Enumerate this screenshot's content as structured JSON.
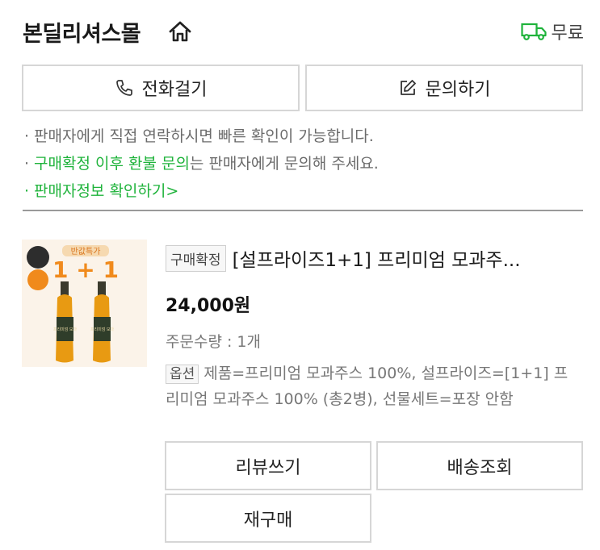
{
  "header": {
    "store_name": "본딜리셔스몰",
    "shipping_label": "무료",
    "accent_color": "#1fb33b"
  },
  "contact_buttons": {
    "call_label": "전화걸기",
    "inquiry_label": "문의하기"
  },
  "notes": {
    "line1": "판매자에게 직접 연락하시면 빠른 확인이 가능합니다.",
    "line2_highlight": "구매확정 이후 환불 문의",
    "line2_rest": "는 판매자에게 문의해 주세요.",
    "line3_link": "판매자정보 확인하기",
    "line3_chevron": ">"
  },
  "order": {
    "status_badge": "구매확정",
    "product_title": "[설프라이즈1+1] 프리미엄 모과주...",
    "price": "24,000원",
    "quantity": "주문수량 : 1개",
    "option_label": "옵션",
    "option_text": "제품=프리미엄 모과주스 100%, 설프라이즈=[1+1] 프리미엄 모과주스 100% (총2병), 선물세트=포장 안함",
    "thumbnail": {
      "promo_text": "반값특가",
      "big_text": "1 + 1",
      "bottle_label": "프리미엄 모과"
    }
  },
  "actions": {
    "review_label": "리뷰쓰기",
    "tracking_label": "배송조회",
    "reorder_label": "재구매"
  }
}
